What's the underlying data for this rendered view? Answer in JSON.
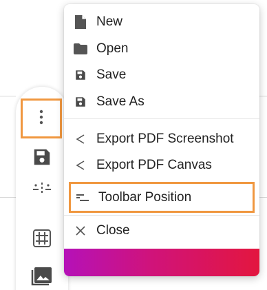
{
  "menu": {
    "items": [
      {
        "label": "New",
        "icon": "file-icon"
      },
      {
        "label": "Open",
        "icon": "folder-icon"
      },
      {
        "label": "Save",
        "icon": "save-icon"
      },
      {
        "label": "Save As",
        "icon": "save-icon"
      },
      {
        "label": "Export PDF Screenshot",
        "icon": "share-icon"
      },
      {
        "label": "Export PDF Canvas",
        "icon": "share-icon"
      },
      {
        "label": "Toolbar Position",
        "icon": "toolbar-position-icon"
      },
      {
        "label": "Close",
        "icon": "close-icon"
      }
    ]
  },
  "toolbar": {
    "buttons": [
      "more-vert-icon",
      "save-icon",
      "split-view-icon",
      "grid-icon",
      "image-icon"
    ]
  },
  "colors": {
    "highlight": "#f0973f",
    "gradient_start": "#b511b8",
    "gradient_end": "#e3163f"
  }
}
